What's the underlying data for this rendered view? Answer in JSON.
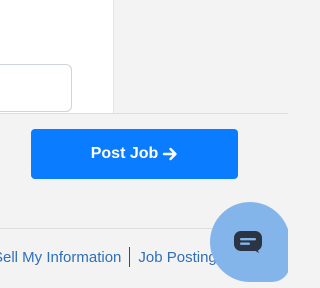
{
  "form": {
    "input_value": ""
  },
  "post_job": {
    "label": "Post Job",
    "icon": "arrow-right-icon",
    "color": "#0a7cff"
  },
  "footer": {
    "links": [
      {
        "label": "Sell My Information"
      },
      {
        "label": "Job Postings"
      }
    ],
    "link_color": "#2f6fb8"
  },
  "chat": {
    "icon": "chat-icon",
    "color": "#84b5ea"
  }
}
